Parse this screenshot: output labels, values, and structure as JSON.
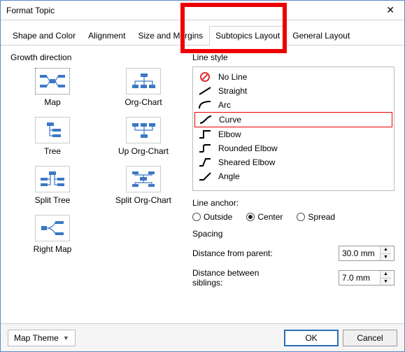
{
  "window": {
    "title": "Format Topic"
  },
  "tabs": {
    "items": [
      {
        "label": "Shape and Color"
      },
      {
        "label": "Alignment"
      },
      {
        "label": "Size and Margins"
      },
      {
        "label": "Subtopics Layout"
      },
      {
        "label": "General Layout"
      }
    ],
    "active_index": 3
  },
  "growth": {
    "label": "Growth direction",
    "items": [
      {
        "label": "Map",
        "icon": "map-icon"
      },
      {
        "label": "Org-Chart",
        "icon": "orgchart-icon"
      },
      {
        "label": "Tree",
        "icon": "tree-icon"
      },
      {
        "label": "Up Org-Chart",
        "icon": "uporgchart-icon"
      },
      {
        "label": "Split Tree",
        "icon": "splittree-icon"
      },
      {
        "label": "Split Org-Chart",
        "icon": "splitorgchart-icon"
      },
      {
        "label": "Right Map",
        "icon": "rightmap-icon"
      }
    ],
    "selected_index": 0
  },
  "linestyle": {
    "label": "Line style",
    "items": [
      {
        "label": "No Line",
        "icon": "noline-icon"
      },
      {
        "label": "Straight",
        "icon": "straight-icon"
      },
      {
        "label": "Arc",
        "icon": "arc-icon"
      },
      {
        "label": "Curve",
        "icon": "curve-icon"
      },
      {
        "label": "Elbow",
        "icon": "elbow-icon"
      },
      {
        "label": "Rounded Elbow",
        "icon": "roundedelbow-icon"
      },
      {
        "label": "Sheared Elbow",
        "icon": "shearedelbow-icon"
      },
      {
        "label": "Angle",
        "icon": "angle-icon"
      }
    ],
    "selected_index": 3
  },
  "anchor": {
    "label": "Line anchor:",
    "options": [
      "Outside",
      "Center",
      "Spread"
    ],
    "selected_index": 1
  },
  "spacing": {
    "label": "Spacing",
    "distance_parent_label": "Distance from parent:",
    "distance_parent_value": "30.0 mm",
    "distance_siblings_label": "Distance between siblings:",
    "distance_siblings_value": "7.0 mm"
  },
  "footer": {
    "map_theme": "Map Theme",
    "ok": "OK",
    "cancel": "Cancel"
  }
}
